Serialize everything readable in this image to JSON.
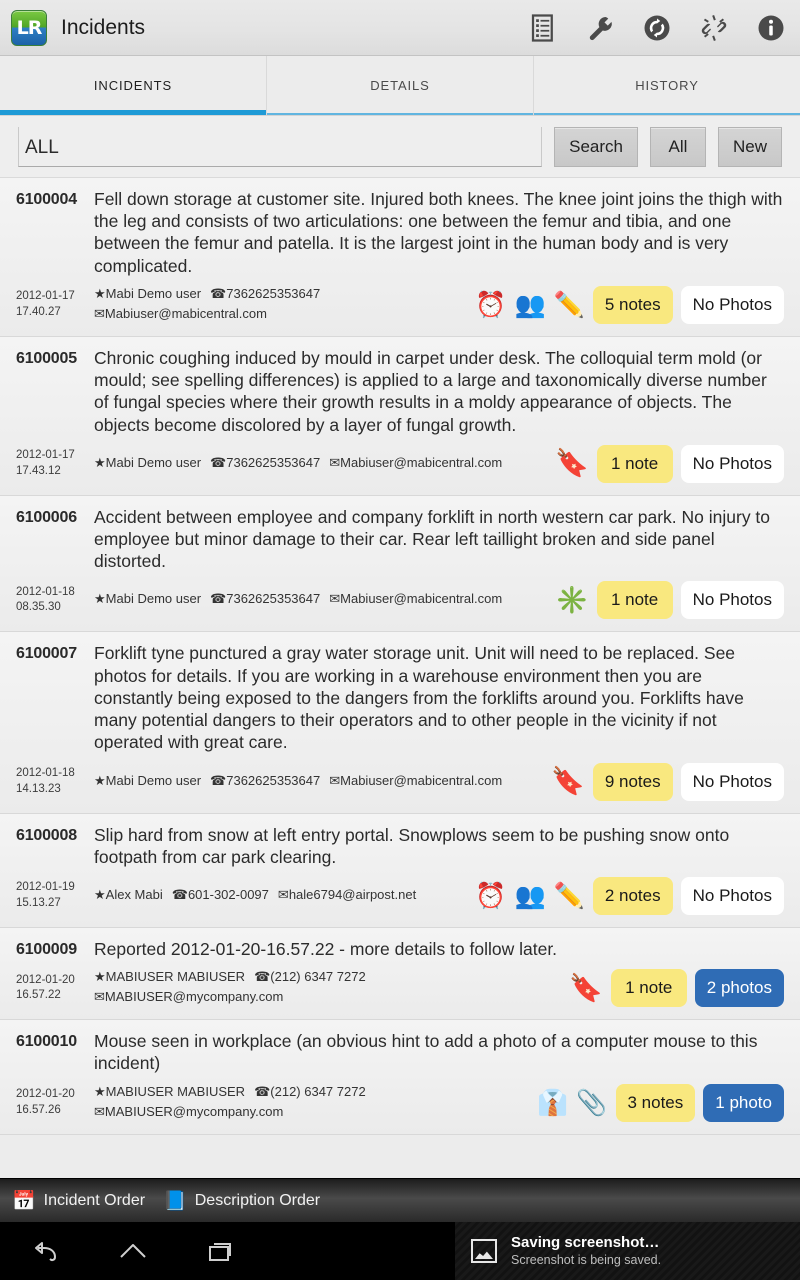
{
  "actionbar": {
    "logo_text": "LR",
    "title": "Incidents",
    "icons": [
      {
        "name": "form-list-icon"
      },
      {
        "name": "wrench-icon"
      },
      {
        "name": "sync-icon"
      },
      {
        "name": "broken-link-icon"
      },
      {
        "name": "info-icon"
      }
    ]
  },
  "tabs": [
    {
      "label": "INCIDENTS",
      "active": true
    },
    {
      "label": "DETAILS",
      "active": false
    },
    {
      "label": "HISTORY",
      "active": false
    }
  ],
  "search": {
    "value": "ALL",
    "placeholder": "",
    "search_label": "Search",
    "all_label": "All",
    "new_label": "New"
  },
  "incidents": [
    {
      "id": "6100004",
      "description": "Fell down storage at customer site. Injured both knees. The knee joint joins the thigh with the leg and consists of two articulations: one between the femur and tibia, and one between the femur and patella. It is the largest joint in the human body and is very complicated.",
      "date": "2012-01-17",
      "time": "17.40.27",
      "user": "Mabi Demo user",
      "phone": "7362625353647",
      "email": "Mabiuser@mabicentral.com",
      "meta_wrap": true,
      "emojis": [
        "alarm-clock-icon",
        "business-people-icon",
        "pencil-icon"
      ],
      "notes_label": "5 notes",
      "photos_label": "No Photos",
      "has_photos": false
    },
    {
      "id": "6100005",
      "description": "Chronic coughing induced by mould in carpet under desk. The colloquial term mold (or mould; see spelling differences) is applied to a large and taxonomically diverse number of fungal species where their growth results in a moldy appearance of objects. The objects become discolored by a layer of fungal growth.",
      "date": "2012-01-17",
      "time": "17.43.12",
      "user": "Mabi Demo user",
      "phone": "7362625353647",
      "email": "Mabiuser@mabicentral.com",
      "meta_wrap": false,
      "emojis": [
        "bookmark-tag-icon"
      ],
      "notes_label": "1 note",
      "photos_label": "No Photos",
      "has_photos": false
    },
    {
      "id": "6100006",
      "description": "Accident between employee and company forklift in north western car park. No injury to employee but minor damage to their car. Rear left taillight broken and side panel distorted.",
      "date": "2012-01-18",
      "time": "08.35.30",
      "user": "Mabi Demo user",
      "phone": "7362625353647",
      "email": "Mabiuser@mabicentral.com",
      "meta_wrap": false,
      "emojis": [
        "sparkle-asterisk-icon"
      ],
      "notes_label": "1 note",
      "photos_label": "No Photos",
      "has_photos": false
    },
    {
      "id": "6100007",
      "description": "Forklift tyne punctured a gray water storage unit. Unit will need to be replaced. See photos for details. If you are working in a warehouse environment then you are constantly being exposed to the dangers from the forklifts around you.  Forklifts have many potential dangers to their operators and to other people in the vicinity if not operated with great care.",
      "date": "2012-01-18",
      "time": "14.13.23",
      "user": "Mabi Demo user",
      "phone": "7362625353647",
      "email": "Mabiuser@mabicentral.com",
      "meta_wrap": false,
      "emojis": [
        "bookmark-tag-icon"
      ],
      "notes_label": "9 notes",
      "photos_label": "No Photos",
      "has_photos": false
    },
    {
      "id": "6100008",
      "description": "Slip hard from snow at left entry portal. Snowplows seem to be pushing snow onto footpath from car park clearing.",
      "date": "2012-01-19",
      "time": "15.13.27",
      "user": "Alex Mabi",
      "phone": "601-302-0097",
      "email": "hale6794@airpost.net",
      "meta_wrap": false,
      "emojis": [
        "alarm-clock-icon",
        "business-people-icon",
        "pencil-icon"
      ],
      "notes_label": "2 notes",
      "photos_label": "No Photos",
      "has_photos": false
    },
    {
      "id": "6100009",
      "description": "Reported 2012-01-20-16.57.22 - more details to follow later.",
      "date": "2012-01-20",
      "time": "16.57.22",
      "user": "MABIUSER MABIUSER",
      "phone": "(212) 6347 7272",
      "email": "MABIUSER@mycompany.com",
      "meta_wrap": false,
      "emojis": [
        "bookmark-tag-icon"
      ],
      "notes_label": "1 note",
      "photos_label": "2 photos",
      "has_photos": true
    },
    {
      "id": "6100010",
      "description": "Mouse seen in workplace (an obvious hint to add a photo of a computer mouse to this incident)",
      "date": "2012-01-20",
      "time": "16.57.26",
      "user": "MABIUSER MABIUSER",
      "phone": "(212) 6347 7272",
      "email": "MABIUSER@mycompany.com",
      "meta_wrap": true,
      "emojis": [
        "businessman-icon",
        "paperclip-icon"
      ],
      "notes_label": "3 notes",
      "photos_label": "1 photo",
      "has_photos": true
    }
  ],
  "sortbar": [
    {
      "label": "Incident Order",
      "icon": "calendar-icon"
    },
    {
      "label": "Description Order",
      "icon": "list-book-icon"
    }
  ],
  "navbar": {
    "back": "back-icon",
    "home": "home-icon",
    "recents": "recents-icon"
  },
  "toast": {
    "icon": "image-icon",
    "title": "Saving screenshot…",
    "subtitle": "Screenshot is being saved."
  },
  "colors": {
    "accent_blue": "#1e9ad6",
    "notes_yellow": "#f9e87f",
    "photos_blue": "#2f6cb5"
  }
}
